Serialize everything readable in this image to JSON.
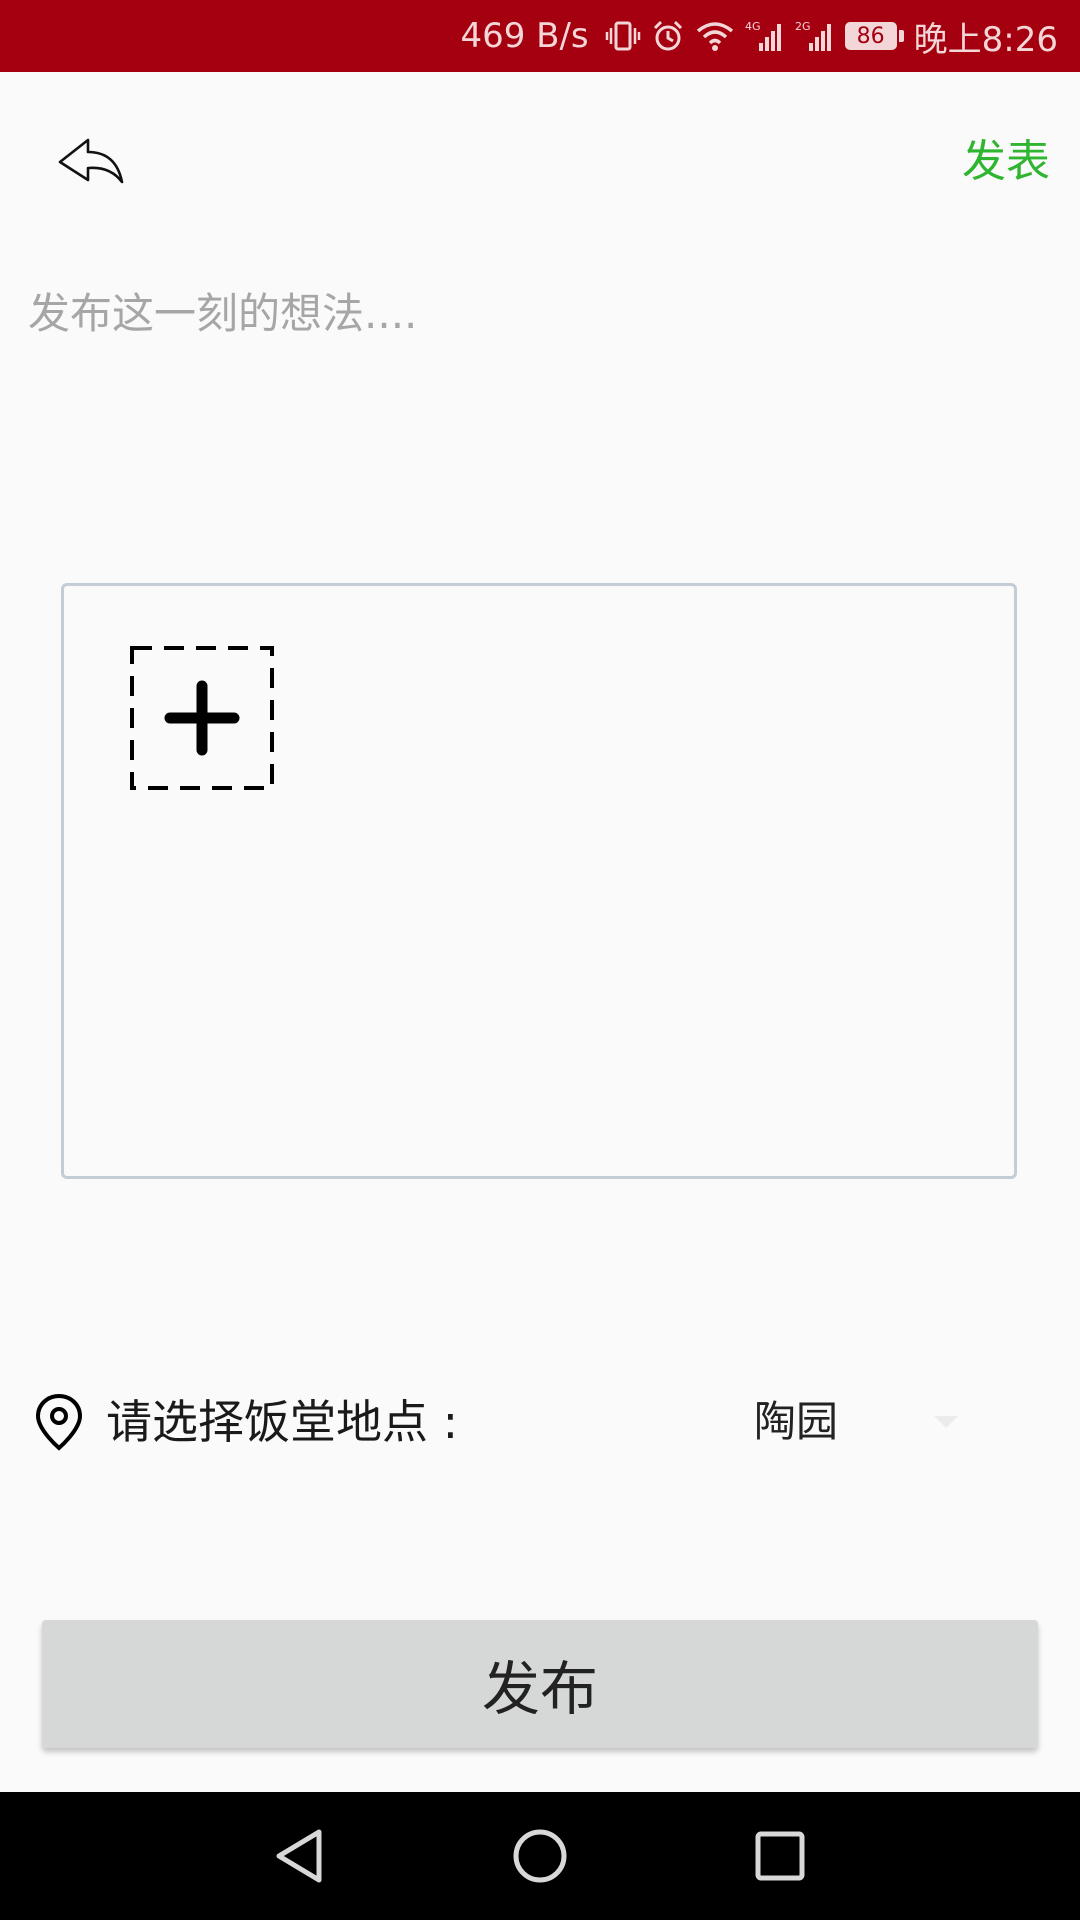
{
  "status_bar": {
    "net_speed": "469 B/s",
    "network_1": "4G",
    "network_2": "2G",
    "battery_level": "86",
    "time": "晚上8:26",
    "background_color": "#a5000f"
  },
  "header": {
    "back_icon": "back-arrow-icon",
    "publish_label": "发表",
    "publish_color": "#2fb52f"
  },
  "composer": {
    "placeholder": "发布这一刻的想法....",
    "value": ""
  },
  "images": {
    "add_icon": "add-image-plus-icon"
  },
  "location": {
    "icon": "location-pin-icon",
    "label": "请选择饭堂地点 :",
    "selected": "陶园"
  },
  "submit": {
    "label": "发布"
  },
  "nav": {
    "back_icon": "triangle-back-icon",
    "home_icon": "circle-home-icon",
    "recent_icon": "square-recent-icon"
  }
}
